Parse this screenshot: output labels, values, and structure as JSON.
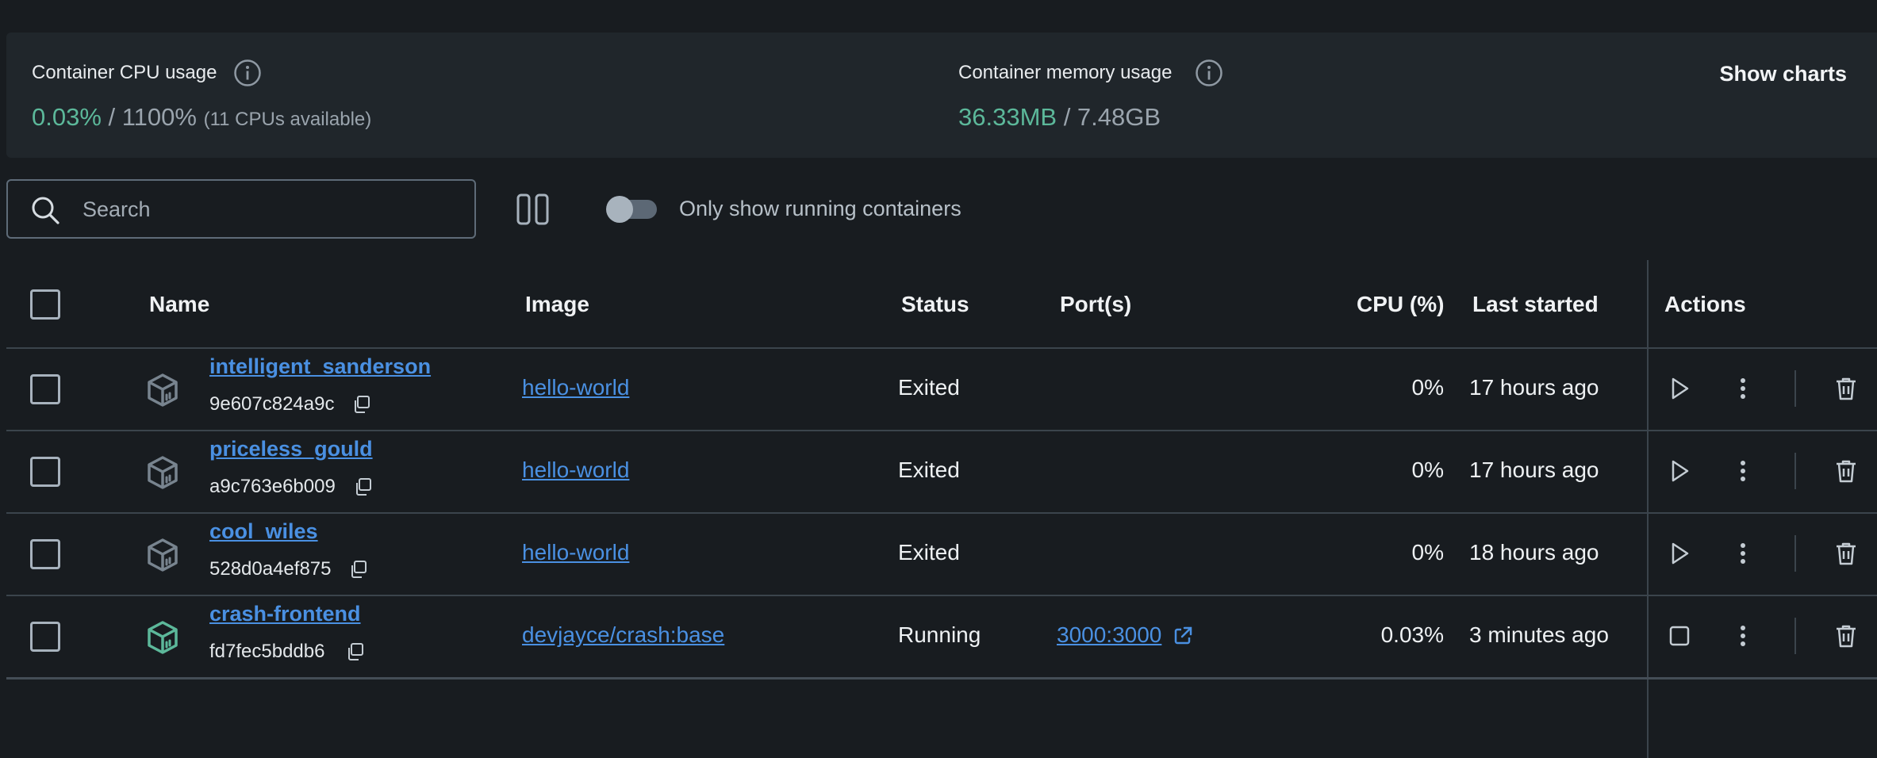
{
  "stats": {
    "cpu": {
      "label": "Container CPU usage",
      "used": "0.03%",
      "sep_total": " / 1100%",
      "note": "(11 CPUs available)"
    },
    "memory": {
      "label": "Container memory usage",
      "used": "36.33MB",
      "sep_total": " / 7.48GB"
    },
    "show_charts": "Show charts"
  },
  "toolbar": {
    "search_placeholder": "Search",
    "toggle_label": "Only show running containers"
  },
  "table": {
    "headers": {
      "name": "Name",
      "image": "Image",
      "status": "Status",
      "ports": "Port(s)",
      "cpu": "CPU (%)",
      "last_started": "Last started",
      "actions": "Actions"
    },
    "rows": [
      {
        "name": "intelligent_sanderson",
        "id": "9e607c824a9c",
        "image": "hello-world",
        "status": "Exited",
        "port": "",
        "cpu": "0%",
        "last_started": "17 hours ago",
        "running": false
      },
      {
        "name": "priceless_gould",
        "id": "a9c763e6b009",
        "image": "hello-world",
        "status": "Exited",
        "port": "",
        "cpu": "0%",
        "last_started": "17 hours ago",
        "running": false
      },
      {
        "name": "cool_wiles",
        "id": "528d0a4ef875",
        "image": "hello-world",
        "status": "Exited",
        "port": "",
        "cpu": "0%",
        "last_started": "18 hours ago",
        "running": false
      },
      {
        "name": "crash-frontend",
        "id": "fd7fec5bddb6",
        "image": "devjayce/crash:base",
        "status": "Running",
        "port": "3000:3000",
        "cpu": "0.03%",
        "last_started": "3 minutes ago",
        "running": true
      }
    ]
  },
  "colors": {
    "accent_green": "#5cb89a",
    "link_blue": "#4a90e2",
    "background": "#181c20",
    "panel": "#20262b"
  },
  "icons": {
    "info": "info-icon",
    "search": "search-icon",
    "columns": "columns-icon",
    "container": "container-cube-icon",
    "copy": "copy-icon",
    "external": "external-link-icon",
    "start": "play-icon",
    "stop": "stop-icon",
    "more": "kebab-menu-icon",
    "delete": "trash-icon"
  }
}
